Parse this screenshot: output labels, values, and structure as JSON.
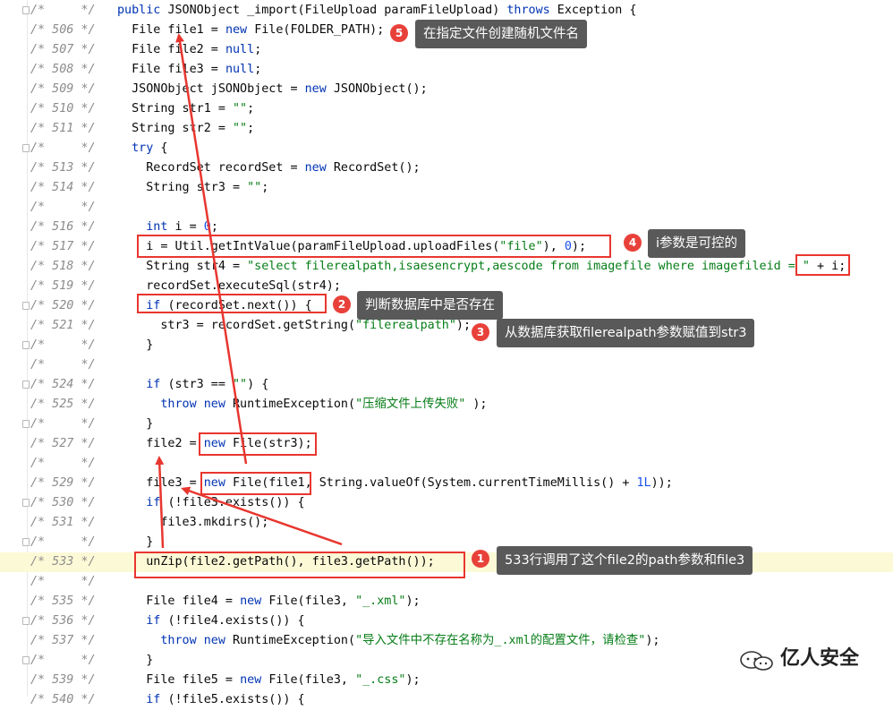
{
  "lines": [
    {
      "gutter": "/*     */",
      "fold": true,
      "segments": [
        [
          "kw",
          "public "
        ],
        [
          "t",
          "JSONObject _import(FileUpload paramFileUpload) "
        ],
        [
          "kw",
          "throws "
        ],
        [
          "t",
          "Exception {"
        ]
      ]
    },
    {
      "gutter": "/* 506 */",
      "segments": [
        [
          "t",
          "  File file1 = "
        ],
        [
          "kw",
          "new "
        ],
        [
          "t",
          "File(FOLDER_PATH);"
        ]
      ]
    },
    {
      "gutter": "/* 507 */",
      "segments": [
        [
          "t",
          "  File file2 = "
        ],
        [
          "kw",
          "null"
        ],
        [
          "t",
          ";"
        ]
      ]
    },
    {
      "gutter": "/* 508 */",
      "segments": [
        [
          "t",
          "  File file3 = "
        ],
        [
          "kw",
          "null"
        ],
        [
          "t",
          ";"
        ]
      ]
    },
    {
      "gutter": "/* 509 */",
      "segments": [
        [
          "t",
          "  JSONObject jSONObject = "
        ],
        [
          "kw",
          "new "
        ],
        [
          "t",
          "JSONObject();"
        ]
      ]
    },
    {
      "gutter": "/* 510 */",
      "segments": [
        [
          "t",
          "  String str1 = "
        ],
        [
          "str",
          "\"\""
        ],
        [
          "t",
          ";"
        ]
      ]
    },
    {
      "gutter": "/* 511 */",
      "segments": [
        [
          "t",
          "  String str2 = "
        ],
        [
          "str",
          "\"\""
        ],
        [
          "t",
          ";"
        ]
      ]
    },
    {
      "gutter": "/*     */",
      "fold": true,
      "segments": [
        [
          "t",
          "  "
        ],
        [
          "kw",
          "try "
        ],
        [
          "t",
          "{"
        ]
      ]
    },
    {
      "gutter": "/* 513 */",
      "segments": [
        [
          "t",
          "    RecordSet recordSet = "
        ],
        [
          "kw",
          "new "
        ],
        [
          "t",
          "RecordSet();"
        ]
      ]
    },
    {
      "gutter": "/* 514 */",
      "segments": [
        [
          "t",
          "    String str3 = "
        ],
        [
          "str",
          "\"\""
        ],
        [
          "t",
          ";"
        ]
      ]
    },
    {
      "gutter": "/*     */",
      "segments": []
    },
    {
      "gutter": "/* 516 */",
      "segments": [
        [
          "t",
          "    "
        ],
        [
          "kw",
          "int "
        ],
        [
          "t",
          "i = "
        ],
        [
          "num",
          "0"
        ],
        [
          "t",
          ";"
        ]
      ]
    },
    {
      "gutter": "/* 517 */",
      "segments": [
        [
          "t",
          "    i = Util.getIntValue(paramFileUpload.uploadFiles("
        ],
        [
          "str",
          "\"file\""
        ],
        [
          "t",
          "), "
        ],
        [
          "num",
          "0"
        ],
        [
          "t",
          ");"
        ]
      ]
    },
    {
      "gutter": "/* 518 */",
      "segments": [
        [
          "t",
          "    String str4 = "
        ],
        [
          "str",
          "\"select filerealpath,isaesencrypt,aescode from imagefile where imagefileid = \""
        ],
        [
          "t",
          " + i;"
        ]
      ]
    },
    {
      "gutter": "/* 519 */",
      "segments": [
        [
          "t",
          "    recordSet.executeSql(str4);"
        ]
      ]
    },
    {
      "gutter": "/* 520 */",
      "fold": true,
      "segments": [
        [
          "t",
          "    "
        ],
        [
          "kw",
          "if "
        ],
        [
          "t",
          "(recordSet.next()) {"
        ]
      ]
    },
    {
      "gutter": "/* 521 */",
      "segments": [
        [
          "t",
          "      str3 = recordSet.getString("
        ],
        [
          "str",
          "\"filerealpath\""
        ],
        [
          "t",
          ");"
        ]
      ]
    },
    {
      "gutter": "/*     */",
      "fold": true,
      "segments": [
        [
          "t",
          "    }"
        ]
      ]
    },
    {
      "gutter": "/*     */",
      "segments": []
    },
    {
      "gutter": "/* 524 */",
      "fold": true,
      "segments": [
        [
          "t",
          "    "
        ],
        [
          "kw",
          "if "
        ],
        [
          "t",
          "(str3 == "
        ],
        [
          "str",
          "\"\""
        ],
        [
          "t",
          ") {"
        ]
      ]
    },
    {
      "gutter": "/* 525 */",
      "segments": [
        [
          "t",
          "      "
        ],
        [
          "kw",
          "throw new "
        ],
        [
          "t",
          "RuntimeException("
        ],
        [
          "str",
          "\"压缩文件上传失败\""
        ],
        [
          "t",
          " );"
        ]
      ]
    },
    {
      "gutter": "/*     */",
      "fold": true,
      "segments": [
        [
          "t",
          "    }"
        ]
      ]
    },
    {
      "gutter": "/* 527 */",
      "segments": [
        [
          "t",
          "    file2 = "
        ],
        [
          "kw",
          "new "
        ],
        [
          "t",
          "File(str3);"
        ]
      ]
    },
    {
      "gutter": "/*     */",
      "segments": []
    },
    {
      "gutter": "/* 529 */",
      "segments": [
        [
          "t",
          "    file3 = "
        ],
        [
          "kw",
          "new "
        ],
        [
          "t",
          "File(file1, String.valueOf(System.currentTimeMillis() + "
        ],
        [
          "num",
          "1L"
        ],
        [
          "t",
          "));"
        ]
      ]
    },
    {
      "gutter": "/* 530 */",
      "fold": true,
      "segments": [
        [
          "t",
          "    "
        ],
        [
          "kw",
          "if "
        ],
        [
          "t",
          "(!file3.exists()) {"
        ]
      ]
    },
    {
      "gutter": "/* 531 */",
      "segments": [
        [
          "t",
          "      file3.mkdirs();"
        ]
      ]
    },
    {
      "gutter": "/*     */",
      "fold": true,
      "segments": [
        [
          "t",
          "    }"
        ]
      ]
    },
    {
      "gutter": "/* 533 */",
      "highlight": true,
      "segments": [
        [
          "t",
          "    unZip(file2.getPath(), file3.getPath());"
        ]
      ]
    },
    {
      "gutter": "/*     */",
      "segments": []
    },
    {
      "gutter": "/* 535 */",
      "segments": [
        [
          "t",
          "    File file4 = "
        ],
        [
          "kw",
          "new "
        ],
        [
          "t",
          "File(file3, "
        ],
        [
          "str",
          "\"_.xml\""
        ],
        [
          "t",
          ");"
        ]
      ]
    },
    {
      "gutter": "/* 536 */",
      "fold": true,
      "segments": [
        [
          "t",
          "    "
        ],
        [
          "kw",
          "if "
        ],
        [
          "t",
          "(!file4.exists()) {"
        ]
      ]
    },
    {
      "gutter": "/* 537 */",
      "segments": [
        [
          "t",
          "      "
        ],
        [
          "kw",
          "throw new "
        ],
        [
          "t",
          "RuntimeException("
        ],
        [
          "str",
          "\"导入文件中不存在名称为_.xml的配置文件，请检查\""
        ],
        [
          "t",
          ");"
        ]
      ]
    },
    {
      "gutter": "/*     */",
      "fold": true,
      "segments": [
        [
          "t",
          "    }"
        ]
      ]
    },
    {
      "gutter": "/* 539 */",
      "segments": [
        [
          "t",
          "    File file5 = "
        ],
        [
          "kw",
          "new "
        ],
        [
          "t",
          "File(file3, "
        ],
        [
          "str",
          "\"_.css\""
        ],
        [
          "t",
          ");"
        ]
      ]
    },
    {
      "gutter": "/* 540 */",
      "segments": [
        [
          "t",
          "    "
        ],
        [
          "kw",
          "if "
        ],
        [
          "t",
          "(!file5.exists()) {"
        ]
      ]
    }
  ],
  "annotations": [
    {
      "num": "1",
      "label": "533行调用了这个file2的path参数和file3"
    },
    {
      "num": "2",
      "label": "判断数据库中是否存在"
    },
    {
      "num": "3",
      "label": "从数据库获取filerealpath参数赋值到str3"
    },
    {
      "num": "4",
      "label": "i参数是可控的"
    },
    {
      "num": "5",
      "label": "在指定文件创建随机文件名"
    }
  ],
  "watermark": "亿人安全",
  "accent_color": "#e8362f"
}
